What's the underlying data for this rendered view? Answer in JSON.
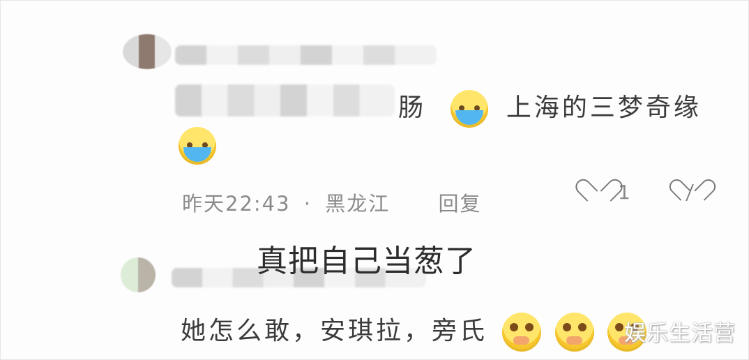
{
  "comments": [
    {
      "text_first": "肠",
      "text_second": "上海的三梦奇缘",
      "meta": {
        "date": "昨天22:43",
        "separator": "·",
        "location": "黑龙江",
        "reply": "回复",
        "likes": "1"
      }
    },
    {
      "caption": "真把自己当葱了",
      "text": "她怎么敢，安琪拉，旁氏"
    }
  ],
  "watermark": "娱乐生活营",
  "icons": [
    "crying-face-icon",
    "heart-icon",
    "broken-heart-icon",
    "pleading-face-icon"
  ]
}
